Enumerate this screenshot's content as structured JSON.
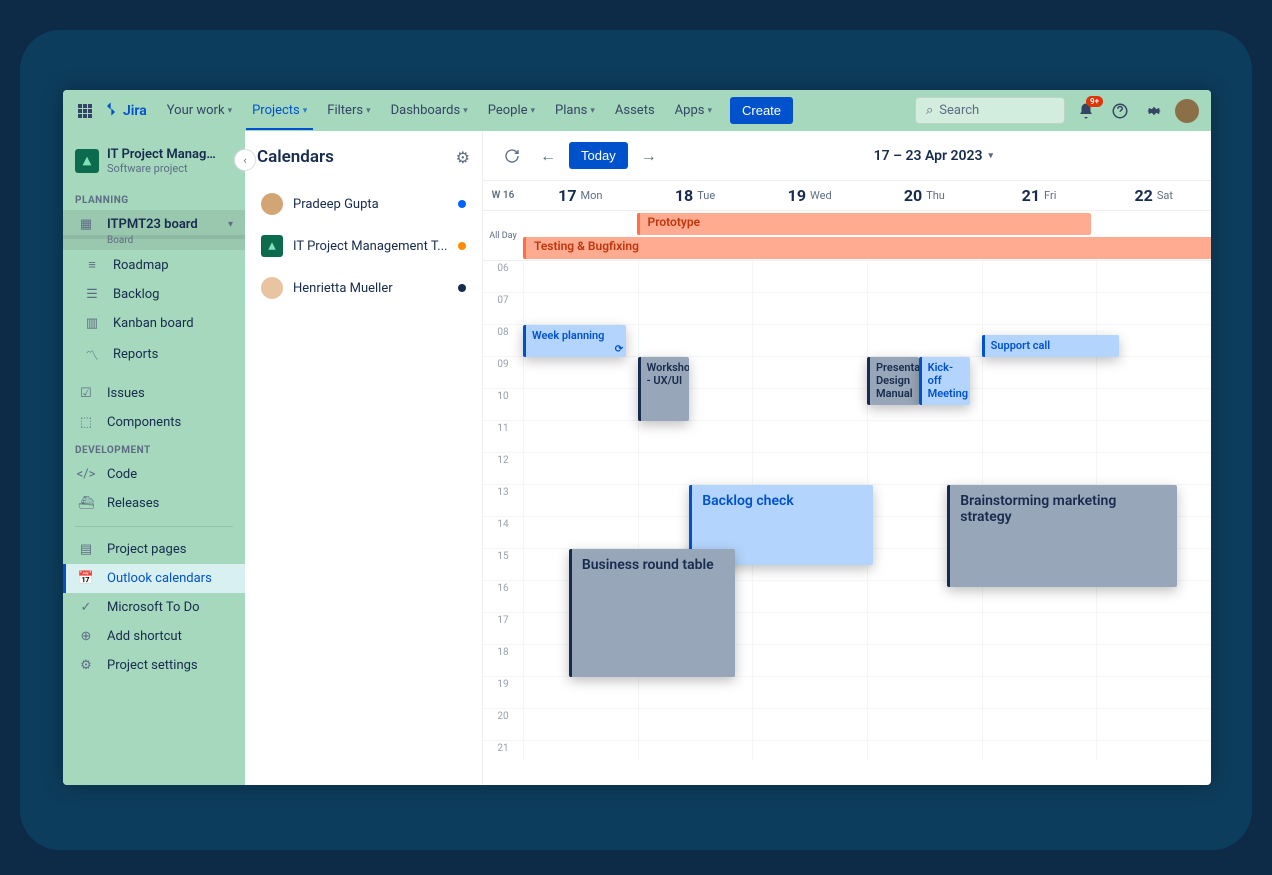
{
  "topbar": {
    "product": "Jira",
    "nav": [
      "Your work",
      "Projects",
      "Filters",
      "Dashboards",
      "People",
      "Plans",
      "Assets",
      "Apps"
    ],
    "active_nav": "Projects",
    "create": "Create",
    "search_placeholder": "Search",
    "notif": "9+"
  },
  "project": {
    "name": "IT Project Managem...",
    "type": "Software project"
  },
  "sidebar": {
    "planning_label": "PLANNING",
    "board_name": "ITPMT23 board",
    "board_sub": "Board",
    "items_planning": [
      "Roadmap",
      "Backlog",
      "Kanban board",
      "Reports"
    ],
    "issues": "Issues",
    "components": "Components",
    "dev_label": "DEVELOPMENT",
    "code": "Code",
    "releases": "Releases",
    "pages": "Project pages",
    "outlook": "Outlook calendars",
    "todo": "Microsoft To Do",
    "shortcut": "Add shortcut",
    "settings": "Project settings"
  },
  "calendars": {
    "title": "Calendars",
    "items": [
      {
        "name": "Pradeep Gupta",
        "color": "#0065ff"
      },
      {
        "name": "IT Project Management T...",
        "color": "#ff8b00"
      },
      {
        "name": "Henrietta Mueller",
        "color": "#172b4d"
      }
    ]
  },
  "calendar": {
    "today": "Today",
    "range": "17 – 23 Apr 2023",
    "week": "W 16",
    "allday_label": "All Day",
    "days": [
      {
        "num": "17",
        "name": "Mon"
      },
      {
        "num": "18",
        "name": "Tue"
      },
      {
        "num": "19",
        "name": "Wed"
      },
      {
        "num": "20",
        "name": "Thu"
      },
      {
        "num": "21",
        "name": "Fri"
      },
      {
        "num": "22",
        "name": "Sat"
      }
    ],
    "hours": [
      "06",
      "07",
      "08",
      "09",
      "10",
      "11",
      "12",
      "13",
      "14",
      "15",
      "16",
      "17",
      "18",
      "19",
      "20",
      "21"
    ],
    "allday_events": [
      {
        "title": "Prototype",
        "left_pct": 16.5,
        "width_pct": 66
      },
      {
        "title": "Testing & Bugfixing",
        "left_pct": 0,
        "width_pct": 105
      }
    ],
    "events": [
      {
        "title": "Week planning",
        "style": "blue",
        "day": 0,
        "start": 8,
        "end": 9,
        "has_sync": true
      },
      {
        "title": "Workshop - UX/UI",
        "style": "gray",
        "day": 1,
        "start": 9,
        "end": 11,
        "width_frac": 0.45
      },
      {
        "title": "Presentation Design Manual",
        "style": "gray",
        "day": 3,
        "start": 9,
        "end": 10.5,
        "width_frac": 0.45
      },
      {
        "title": "Kick-off Meeting",
        "style": "blue",
        "day": 3,
        "start": 9,
        "end": 10.5,
        "width_frac": 0.45,
        "offset_frac": 0.45
      },
      {
        "title": "Support call",
        "style": "blue",
        "day": 4,
        "start": 8.3,
        "end": 9,
        "width_frac": 1.2
      },
      {
        "title": "Backlog check",
        "style": "blue",
        "day": 1,
        "start": 13,
        "end": 15.5,
        "width_frac": 1.6,
        "offset_frac": 0.45,
        "big": true
      },
      {
        "title": "Business round table",
        "style": "gray",
        "day": 0,
        "start": 15,
        "end": 19,
        "width_frac": 1.45,
        "offset_frac": 0.4,
        "big": true
      },
      {
        "title": "Brainstorming marketing strategy",
        "style": "gray",
        "day": 3,
        "start": 13,
        "end": 16.2,
        "width_frac": 2.0,
        "offset_frac": 0.7,
        "big": true
      }
    ]
  }
}
